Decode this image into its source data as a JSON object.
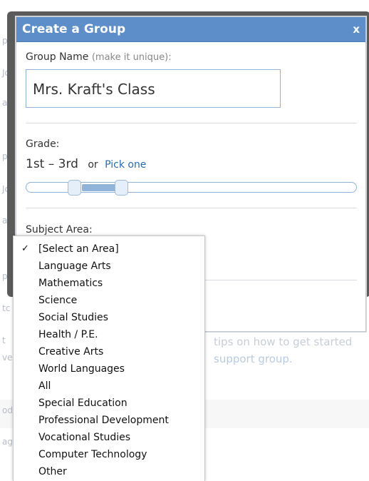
{
  "background": {
    "frag1": "ps",
    "frag2": "Jo",
    "frag3": "ag",
    "frag4": "ps",
    "frag5": "Jo",
    "frag6": "ag",
    "frag7": "ps",
    "frag8": "tc",
    "frag9": "t",
    "frag10": "ve",
    "frag11": "od",
    "frag12": "ag",
    "tips_text": "tips on how to get started",
    "support_text": "support group."
  },
  "dialog": {
    "title": "Create a Group",
    "close": "x",
    "group_name_label": "Group Name",
    "group_name_hint": "(make it unique):",
    "group_name_value": "Mrs. Kraft's Class",
    "grade_label": "Grade:",
    "grade_value": "1st – 3rd",
    "grade_or": "or",
    "grade_pick": "Pick one",
    "grade_range": {
      "min_index": 1,
      "max_index": 3
    },
    "subject_label": "Subject Area:"
  },
  "subject_dropdown": {
    "selected": "[Select an Area]",
    "check": "✓",
    "options": [
      "[Select an Area]",
      "Language Arts",
      "Mathematics",
      "Science",
      "Social Studies",
      "Health / P.E.",
      "Creative Arts",
      "World Languages",
      "All",
      "Special Education",
      "Professional Development",
      "Vocational Studies",
      "Computer Technology",
      "Other"
    ]
  },
  "colors": {
    "titlebar": "#5d8ec9",
    "link": "#2a6cb5",
    "accent_border": "#8fb3d9"
  }
}
